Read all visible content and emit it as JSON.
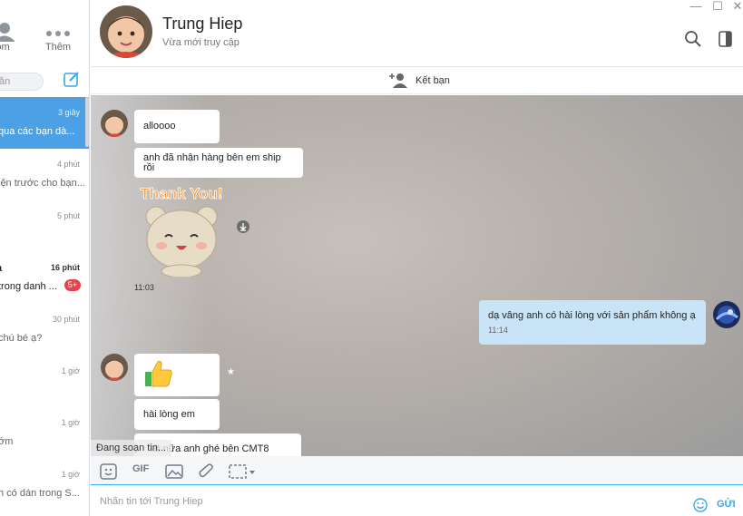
{
  "window": {
    "minimize": "—",
    "maximize": "☐",
    "close": "✕"
  },
  "nav": {
    "contacts_label": "ôm",
    "more_label": "Thêm"
  },
  "search": {
    "placeholder": "ần"
  },
  "conversations": [
    {
      "name": "",
      "preview": "qua các bạn dà...",
      "time": "3 giây",
      "badge": "",
      "active": true
    },
    {
      "name": "",
      "preview": "iện trước cho bạn...",
      "time": "4 phút",
      "badge": ""
    },
    {
      "name": "",
      "preview": "",
      "time": "5 phút",
      "badge": ""
    },
    {
      "name": "ạ",
      "preview": "trong danh ...",
      "time": "16 phút",
      "badge": "5+"
    },
    {
      "name": "",
      "preview": "chú bé ạ?",
      "time": "30 phút",
      "badge": ""
    },
    {
      "name": "",
      "preview": "",
      "time": "1 giờ",
      "badge": ""
    },
    {
      "name": "",
      "preview": "ớm",
      "time": "1 giờ",
      "badge": ""
    },
    {
      "name": "",
      "preview": "h có dán trong S...",
      "time": "1 giờ",
      "badge": ""
    }
  ],
  "header": {
    "contact_name": "Trung Hiep",
    "status": "Vừa mới truy cập"
  },
  "friend_bar": {
    "label": "Kết bạn"
  },
  "messages": {
    "m1": "alloooo",
    "m2": "anh đã nhận hàng bên em ship rồi",
    "sticker_text": "Thank You!",
    "sticker_time": "11:03",
    "m3": "dạ vâng anh có hài lòng với sản phẩm không ạ",
    "m3_time": "11:14",
    "m4": "hài lòng em",
    "m5": "lát nữa anh ghé bên CMT8"
  },
  "typing": "Đang soạn tin...",
  "toolbar": {
    "gif_label": "GIF"
  },
  "composer": {
    "placeholder": "Nhắn tin tới Trung Hiep",
    "send_label": "GỬI"
  },
  "colors": {
    "accent": "#4ba0e6",
    "outgoing_bubble": "#c9e3f7",
    "badge": "#e8414d"
  }
}
